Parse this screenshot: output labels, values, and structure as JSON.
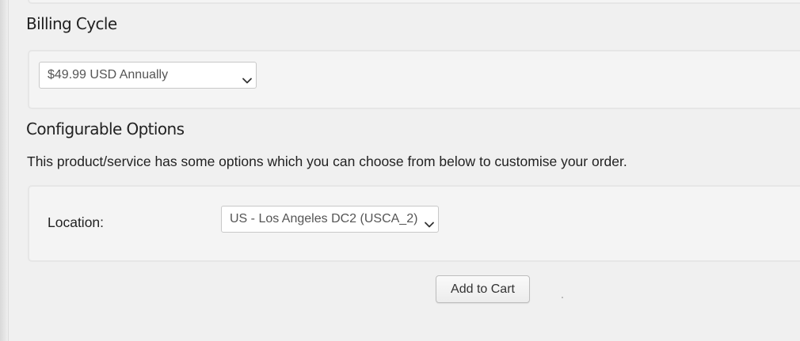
{
  "billing": {
    "heading": "Billing Cycle",
    "selected_option": "$49.99 USD Annually"
  },
  "configurable": {
    "heading": "Configurable Options",
    "description": "This product/service has some options which you can choose from below to customise your order.",
    "location_label": "Location:",
    "location_selected": "US - Los Angeles DC2 (USCA_2)"
  },
  "actions": {
    "add_to_cart_label": "Add to Cart"
  },
  "icons": {
    "dropdown": "chevron-down-icon"
  }
}
